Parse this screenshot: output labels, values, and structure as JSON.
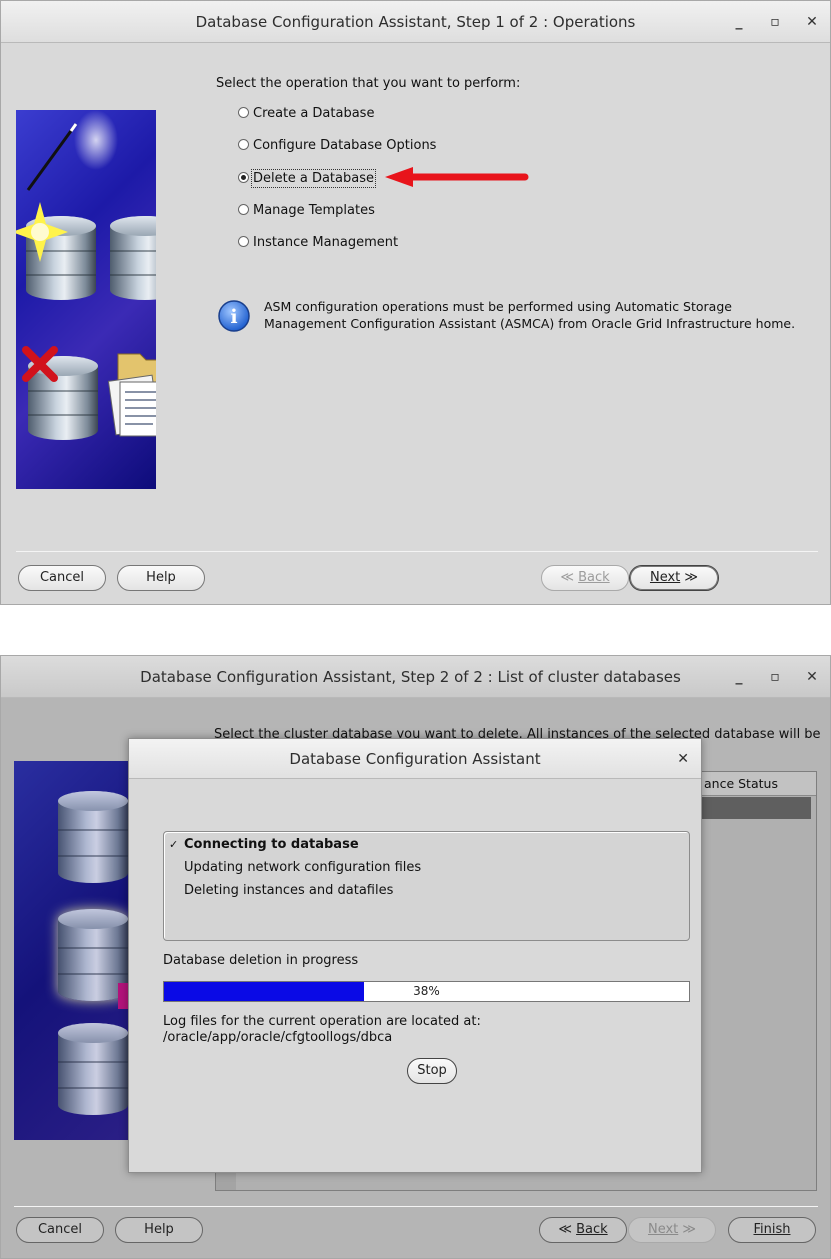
{
  "window1": {
    "title": "Database Configuration Assistant, Step 1 of 2 : Operations",
    "prompt": "Select the operation that you want to perform:",
    "operations": [
      {
        "label": "Create a Database",
        "selected": false
      },
      {
        "label": "Configure Database Options",
        "selected": false
      },
      {
        "label": "Delete a Database",
        "selected": true
      },
      {
        "label": "Manage Templates",
        "selected": false
      },
      {
        "label": "Instance Management",
        "selected": false
      }
    ],
    "info_line1": "ASM configuration operations must be performed using Automatic Storage",
    "info_line2": "Management Configuration Assistant (ASMCA) from Oracle Grid Infrastructure home.",
    "buttons": {
      "cancel": "Cancel",
      "help": "Help",
      "back": "Back",
      "next": "Next"
    },
    "annotation_color": "#e8141b"
  },
  "window2": {
    "title": "Database Configuration Assistant, Step 2 of 2 : List of cluster databases",
    "prompt": "Select the cluster database you want to delete. All instances of the selected database will be",
    "column_fragment": "ance Status",
    "buttons": {
      "cancel": "Cancel",
      "help": "Help",
      "back": "Back",
      "next": "Next",
      "finish": "Finish"
    }
  },
  "dialog": {
    "title": "Database Configuration Assistant",
    "steps": [
      {
        "label": "Connecting to database",
        "active": true
      },
      {
        "label": "Updating network configuration files",
        "active": false
      },
      {
        "label": "Deleting instances and datafiles",
        "active": false
      }
    ],
    "status": "Database deletion in progress",
    "progress": {
      "value": 0.38,
      "label": "38%"
    },
    "log_line1": "Log files for the current operation are located at:",
    "log_line2": "/oracle/app/oracle/cfgtoollogs/dbca",
    "stop_label": "Stop",
    "progress_color": "#0a0ae6"
  }
}
